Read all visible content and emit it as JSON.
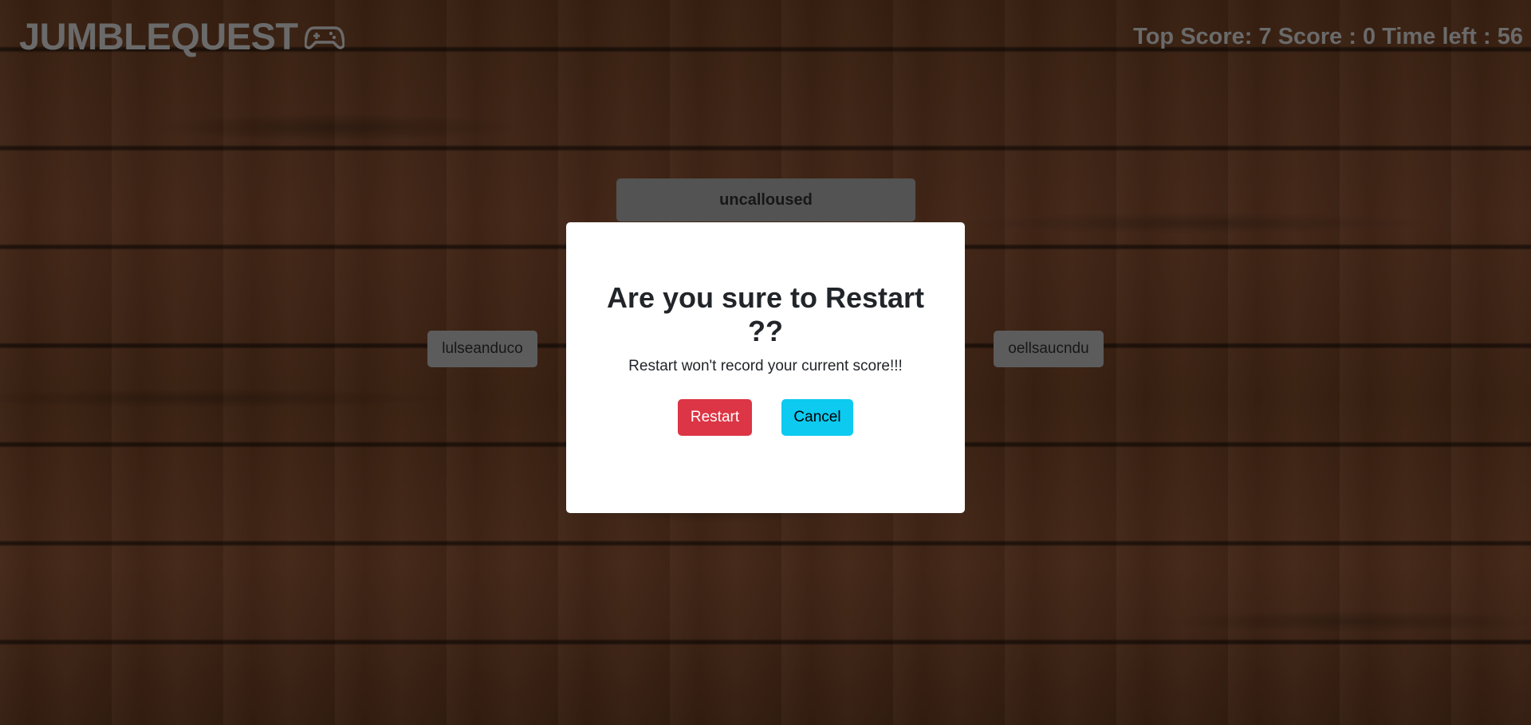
{
  "header": {
    "logo_text": "JUMBLEQUEST",
    "logo_icon": "gamepad-icon",
    "score_text": "Top Score: 7 Score : 0 Time left : 56"
  },
  "words": {
    "top": "uncalloused",
    "left": "lulseanduco",
    "right": "oellsaucndu"
  },
  "modal": {
    "title": "Are you sure to Restart ??",
    "message": "Restart won't record your current score!!!",
    "restart_label": "Restart",
    "cancel_label": "Cancel"
  },
  "colors": {
    "restart": "#dc3545",
    "cancel": "#0dcaf0",
    "tile": "#7b7b7b",
    "header_text": "#8e8e8e"
  }
}
